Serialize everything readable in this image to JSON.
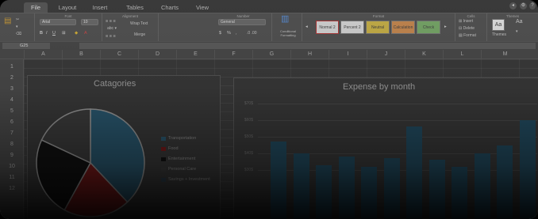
{
  "tabs": [
    {
      "label": "File",
      "active": true
    },
    {
      "label": "Layout",
      "active": false
    },
    {
      "label": "Insert",
      "active": false
    },
    {
      "label": "Tables",
      "active": false
    },
    {
      "label": "Charts",
      "active": false
    },
    {
      "label": "View",
      "active": false
    }
  ],
  "ribbon": {
    "groups": {
      "font": "Font",
      "alignment": "Alignment",
      "number": "Number",
      "format": "Format",
      "cells": "Cells",
      "themes": "Themes"
    },
    "font_name": "Arial",
    "font_size": "10",
    "wrap_text": "Wrap Text",
    "merge": "Merge",
    "number_format": "General",
    "conditional_formatting": "Conditional Formatting",
    "styles": [
      "Normal 2",
      "Percent 2",
      "Neutral",
      "Calculation",
      "Check"
    ],
    "style_colors": [
      "#d6d6d6",
      "#d6d6d6",
      "#c9b24a",
      "#c78a52",
      "#79a96a"
    ],
    "insert": "Insert",
    "delete": "Delete",
    "format": "Format",
    "themes_label": "Themes",
    "aa_label": "Aa"
  },
  "formula_bar": {
    "cell_ref": "G25"
  },
  "columns": [
    "A",
    "B",
    "C",
    "D",
    "E",
    "F",
    "G",
    "H",
    "I",
    "J",
    "K",
    "L",
    "M"
  ],
  "rows": [
    "1",
    "2",
    "3",
    "4",
    "5",
    "6",
    "7",
    "8",
    "9",
    "10",
    "11",
    "12"
  ],
  "chart_data": [
    {
      "type": "pie",
      "title": "Catagories",
      "labels": [
        "Transportation",
        "Food",
        "Entertainment",
        "Personal Care",
        "Savings + Investment"
      ],
      "values": [
        38,
        20,
        24,
        18,
        0
      ],
      "colors": [
        "#2b5a72",
        "#7b1a1a",
        "#121212",
        "#3d3d3d",
        "#2d3d4a"
      ]
    },
    {
      "type": "bar",
      "title": "Expense by month",
      "y_ticks": [
        "$70$",
        "$60$",
        "$50$",
        "$40$",
        "$30$"
      ],
      "values": [
        47,
        40,
        33,
        38,
        32,
        37,
        56,
        36,
        32,
        40,
        45,
        60
      ],
      "ylim": [
        0,
        70
      ],
      "bar_color": "#234d62"
    }
  ]
}
